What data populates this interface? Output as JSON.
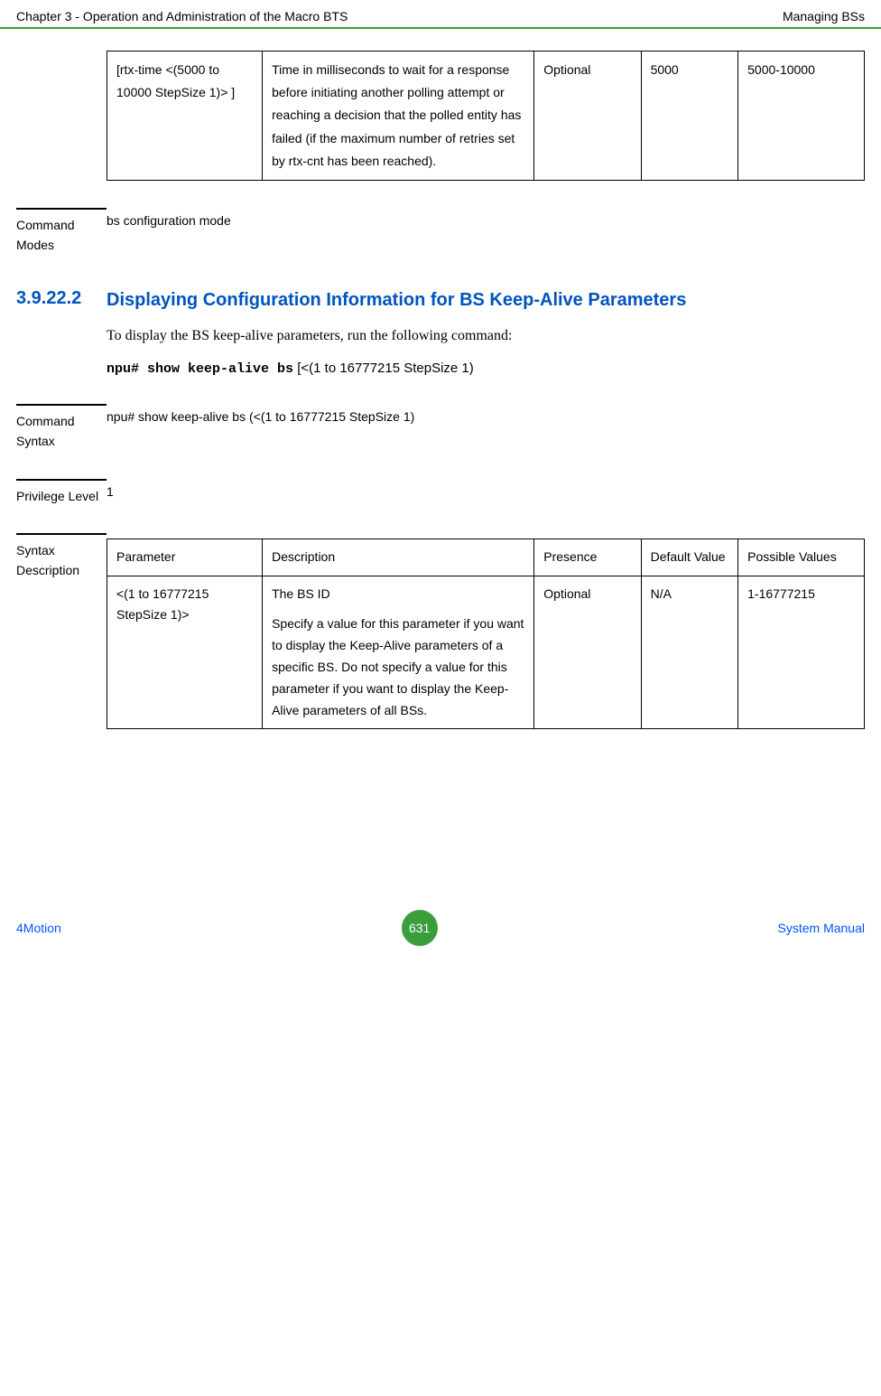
{
  "header": {
    "left": "Chapter 3 - Operation and Administration of the Macro BTS",
    "right": "Managing BSs"
  },
  "topTable": {
    "row": {
      "param": "[rtx-time <(5000 to 10000 StepSize 1)> ]",
      "desc": "Time in milliseconds to wait for a response before initiating another polling attempt or reaching a decision that the polled entity has failed (if the maximum number of retries set by rtx-cnt has been reached).",
      "presence": "Optional",
      "default": "5000",
      "possible": "5000-10000"
    }
  },
  "commandModes": {
    "label": "Command Modes",
    "value": "bs configuration mode"
  },
  "section": {
    "number": "3.9.22.2",
    "title": "Displaying Configuration Information for BS Keep-Alive Parameters"
  },
  "introText": " To display the BS keep-alive parameters, run the following command:",
  "codeLine": {
    "mono": "npu# show keep-alive bs",
    "rest": " [<(1 to 16777215 StepSize 1)"
  },
  "commandSyntax": {
    "label": "Command Syntax",
    "value": "npu# show keep-alive bs (<(1 to 16777215 StepSize 1)"
  },
  "privilegeLevel": {
    "label": "Privilege Level",
    "value": "1"
  },
  "syntaxDesc": {
    "label": "Syntax Description",
    "headers": {
      "param": "Parameter",
      "desc": "Description",
      "presence": "Presence",
      "default": "Default Value",
      "possible": "Possible Values"
    },
    "row": {
      "param": "<(1 to 16777215 StepSize 1)>",
      "desc1": "The BS ID",
      "desc2": "Specify a value for this parameter if you want to display the Keep-Alive parameters of a specific BS. Do not specify a value for this parameter if you want to display the Keep-Alive parameters of all BSs.",
      "presence": "Optional",
      "default": "N/A",
      "possible": "1-16777215"
    }
  },
  "footer": {
    "left": "4Motion",
    "pageNum": "631",
    "right": "System Manual"
  }
}
